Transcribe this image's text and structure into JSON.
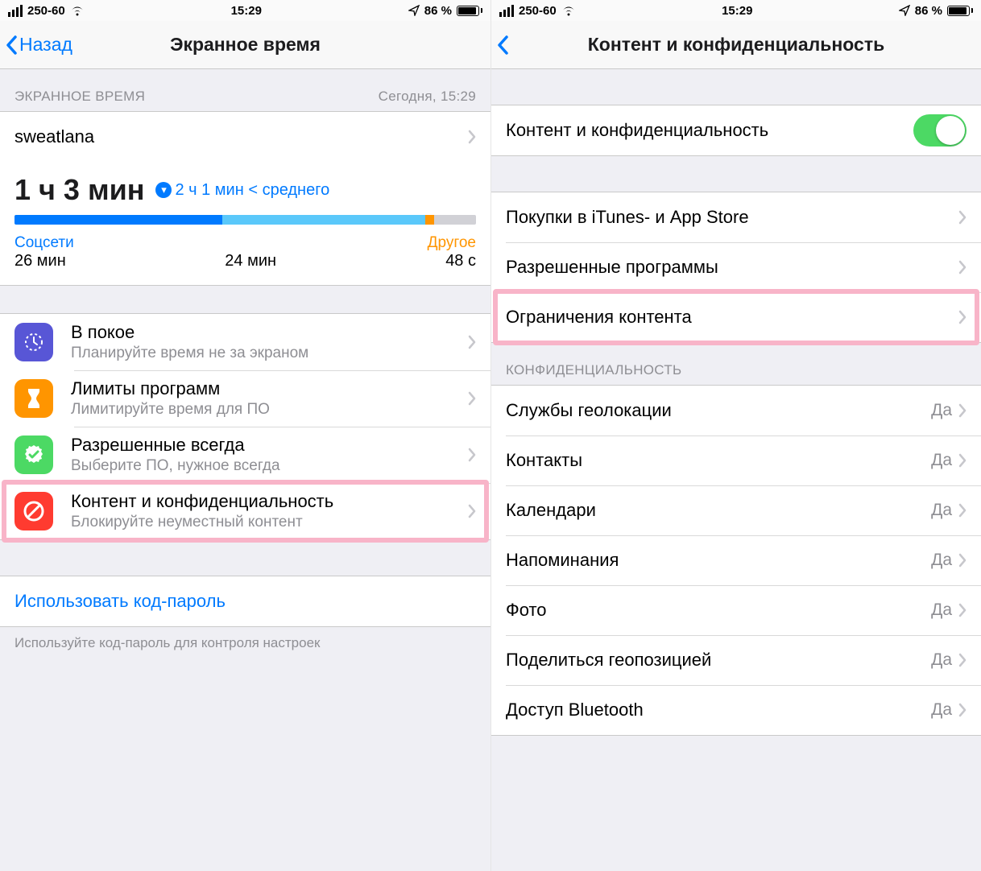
{
  "status": {
    "carrier": "250-60",
    "time": "15:29",
    "battery_text": "86 %"
  },
  "left": {
    "nav": {
      "back": "Назад",
      "title": "Экранное время"
    },
    "section_header": "ЭКРАННОЕ ВРЕМЯ",
    "section_header_right": "Сегодня, 15:29",
    "user": "sweatlana",
    "total_time": "1 ч 3 мин",
    "compare": "2 ч 1 мин < среднего",
    "cats": {
      "c1_name": "Соцсети",
      "c1_time": "26 мин",
      "c2_time": "24 мин",
      "c3_name": "Другое",
      "c3_time": "48 с"
    },
    "options": {
      "o1_title": "В покое",
      "o1_sub": "Планируйте время не за экраном",
      "o2_title": "Лимиты программ",
      "o2_sub": "Лимитируйте время для ПО",
      "o3_title": "Разрешенные всегда",
      "o3_sub": "Выберите ПО, нужное всегда",
      "o4_title": "Контент и конфиденциальность",
      "o4_sub": "Блокируйте неуместный контент"
    },
    "passcode_link": "Использовать код-пароль",
    "footer_note": "Используйте код-пароль для контроля настроек"
  },
  "right": {
    "nav": {
      "title": "Контент и конфиденциальность"
    },
    "toggle_label": "Контент и конфиденциальность",
    "rows": {
      "r1": "Покупки в iTunes- и App Store",
      "r2": "Разрешенные программы",
      "r3": "Ограничения контента"
    },
    "privacy_header": "КОНФИДЕНЦИАЛЬНОСТЬ",
    "privacy_value": "Да",
    "privacy": {
      "p1": "Службы геолокации",
      "p2": "Контакты",
      "p3": "Календари",
      "p4": "Напоминания",
      "p5": "Фото",
      "p6": "Поделиться геопозицией",
      "p7": "Доступ Bluetooth"
    }
  }
}
